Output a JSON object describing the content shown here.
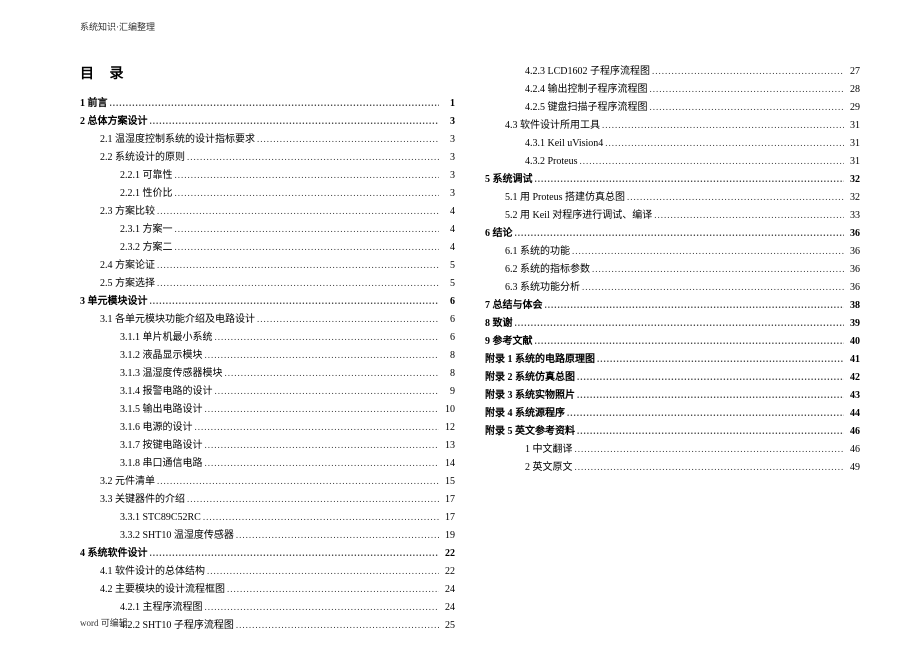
{
  "header": "系统知识·汇编整理",
  "footer": "word 可编辑.",
  "title": "目  录",
  "left": [
    {
      "t": "1 前言",
      "p": "1",
      "c": "b"
    },
    {
      "t": "2 总体方案设计",
      "p": "3",
      "c": "b"
    },
    {
      "t": "2.1 温湿度控制系统的设计指标要求",
      "p": "3",
      "c": "i1"
    },
    {
      "t": "2.2 系统设计的原则",
      "p": "3",
      "c": "i1"
    },
    {
      "t": "2.2.1 可靠性",
      "p": "3",
      "c": "i2"
    },
    {
      "t": "2.2.1 性价比",
      "p": "3",
      "c": "i2"
    },
    {
      "t": "2.3 方案比较",
      "p": "4",
      "c": "i1"
    },
    {
      "t": "2.3.1 方案一",
      "p": "4",
      "c": "i2"
    },
    {
      "t": "2.3.2 方案二",
      "p": "4",
      "c": "i2"
    },
    {
      "t": "2.4 方案论证",
      "p": "5",
      "c": "i1"
    },
    {
      "t": "2.5 方案选择",
      "p": "5",
      "c": "i1"
    },
    {
      "t": "3 单元模块设计",
      "p": "6",
      "c": "b"
    },
    {
      "t": "3.1 各单元模块功能介绍及电路设计",
      "p": "6",
      "c": "i1"
    },
    {
      "t": "3.1.1 单片机最小系统",
      "p": "6",
      "c": "i2"
    },
    {
      "t": "3.1.2 液晶显示模块",
      "p": "8",
      "c": "i2"
    },
    {
      "t": "3.1.3 温湿度传感器模块",
      "p": "8",
      "c": "i2"
    },
    {
      "t": "3.1.4 报警电路的设计",
      "p": "9",
      "c": "i2"
    },
    {
      "t": "3.1.5 输出电路设计",
      "p": "10",
      "c": "i2"
    },
    {
      "t": "3.1.6 电源的设计",
      "p": "12",
      "c": "i2"
    },
    {
      "t": "3.1.7 按键电路设计",
      "p": "13",
      "c": "i2"
    },
    {
      "t": "3.1.8 串口通信电路",
      "p": "14",
      "c": "i2"
    },
    {
      "t": "3.2 元件清单",
      "p": "15",
      "c": "i1"
    },
    {
      "t": "3.3 关键器件的介绍",
      "p": "17",
      "c": "i1"
    },
    {
      "t": "3.3.1 STC89C52RC",
      "p": "17",
      "c": "i2"
    },
    {
      "t": "3.3.2 SHT10 温湿度传感器",
      "p": "19",
      "c": "i2"
    },
    {
      "t": "4 系统软件设计",
      "p": "22",
      "c": "b"
    },
    {
      "t": "4.1 软件设计的总体结构",
      "p": "22",
      "c": "i1"
    },
    {
      "t": "4.2 主要模块的设计流程框图",
      "p": "24",
      "c": "i1"
    },
    {
      "t": "4.2.1 主程序流程图",
      "p": "24",
      "c": "i2"
    },
    {
      "t": "4.2.2 SHT10 子程序流程图",
      "p": "25",
      "c": "i2"
    }
  ],
  "right": [
    {
      "t": "4.2.3 LCD1602 子程序流程图",
      "p": "27",
      "c": "i2"
    },
    {
      "t": "4.2.4 输出控制子程序流程图",
      "p": "28",
      "c": "i2"
    },
    {
      "t": "4.2.5 键盘扫描子程序流程图",
      "p": "29",
      "c": "i2"
    },
    {
      "t": "4.3 软件设计所用工具",
      "p": "31",
      "c": "i1"
    },
    {
      "t": "4.3.1 Keil uVision4",
      "p": "31",
      "c": "i2"
    },
    {
      "t": "4.3.2 Proteus",
      "p": "31",
      "c": "i2"
    },
    {
      "t": "5 系统调试",
      "p": "32",
      "c": "b"
    },
    {
      "t": "5.1 用 Proteus 搭建仿真总图",
      "p": "32",
      "c": "i1"
    },
    {
      "t": "5.2 用 Keil 对程序进行调试、编译",
      "p": "33",
      "c": "i1"
    },
    {
      "t": "6 结论",
      "p": "36",
      "c": "b"
    },
    {
      "t": "6.1 系统的功能",
      "p": "36",
      "c": "i1"
    },
    {
      "t": "6.2 系统的指标参数",
      "p": "36",
      "c": "i1"
    },
    {
      "t": "6.3 系统功能分析",
      "p": "36",
      "c": "i1"
    },
    {
      "t": "7 总结与体会",
      "p": "38",
      "c": "b"
    },
    {
      "t": "8 致谢",
      "p": "39",
      "c": "b"
    },
    {
      "t": "9 参考文献",
      "p": "40",
      "c": "b"
    },
    {
      "t": "附录 1  系统的电路原理图",
      "p": "41",
      "c": "b"
    },
    {
      "t": "附录 2  系统仿真总图",
      "p": "42",
      "c": "b"
    },
    {
      "t": "附录 3  系统实物照片",
      "p": "43",
      "c": "b"
    },
    {
      "t": "附录 4  系统源程序",
      "p": "44",
      "c": "b"
    },
    {
      "t": "附录 5  英文参考资料",
      "p": "46",
      "c": "b"
    },
    {
      "t": "1 中文翻译",
      "p": "46",
      "c": "i2"
    },
    {
      "t": "2 英文原文",
      "p": "49",
      "c": "i2"
    }
  ]
}
